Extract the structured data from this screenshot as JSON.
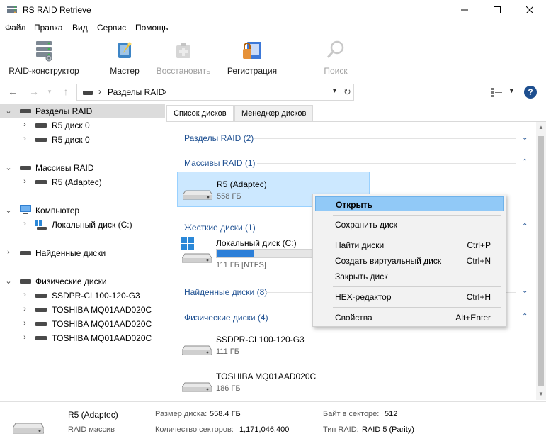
{
  "window": {
    "title": "RS RAID Retrieve"
  },
  "menu": [
    "Файл",
    "Правка",
    "Вид",
    "Сервис",
    "Помощь"
  ],
  "toolbar": {
    "raid_builder": "RAID-конструктор",
    "wizard": "Мастер",
    "restore": "Восстановить",
    "registration": "Регистрация",
    "search": "Поиск"
  },
  "address": {
    "path": "Разделы RAID"
  },
  "tree": {
    "raid_partitions": "Разделы RAID",
    "r5_disk_a": "R5 диск 0",
    "r5_disk_b": "R5 диск 0",
    "raid_arrays": "Массивы RAID",
    "r5_adaptec": "R5 (Adaptec)",
    "computer": "Компьютер",
    "local_disk": "Локальный диск (C:)",
    "found_disks": "Найденные диски",
    "physical_disks": "Физические диски",
    "phys_1": "SSDPR-CL100-120-G3",
    "phys_2": "TOSHIBA MQ01AAD020C",
    "phys_3": "TOSHIBA MQ01AAD020C",
    "phys_4": "TOSHIBA MQ01AAD020C"
  },
  "tabs": {
    "disk_list": "Список дисков",
    "disk_manager": "Менеджер дисков"
  },
  "sections": {
    "raid_partitions": "Разделы RAID (2)",
    "raid_arrays": "Массивы RAID (1)",
    "hard_disks": "Жесткие диски (1)",
    "found_disks": "Найденные диски (8)",
    "physical_disks": "Физические диски (4)"
  },
  "items": {
    "r5": {
      "name": "R5 (Adaptec)",
      "size": "558 ГБ"
    },
    "local": {
      "name": "Локальный диск (C:)",
      "size": "111 ГБ [NTFS]",
      "usage": 0.25
    },
    "ssd": {
      "name": "SSDPR-CL100-120-G3",
      "size": "111 ГБ"
    },
    "toshiba": {
      "name": "TOSHIBA MQ01AAD020C",
      "size": "186 ГБ"
    }
  },
  "context_menu": {
    "open": "Открыть",
    "save_disk": "Сохранить диск",
    "find_disks": "Найти диски",
    "find_disks_key": "Ctrl+P",
    "create_virtual": "Создать виртуальный диск",
    "create_virtual_key": "Ctrl+N",
    "close_disk": "Закрыть диск",
    "hex_editor": "HEX-редактор",
    "hex_editor_key": "Ctrl+H",
    "properties": "Свойства",
    "properties_key": "Alt+Enter"
  },
  "status": {
    "name": "R5 (Adaptec)",
    "type": "RAID массив",
    "disk_size_label": "Размер диска:",
    "disk_size": "558.4 ГБ",
    "sectors_label": "Количество секторов:",
    "sectors": "1,171,046,400",
    "bytes_label": "Байт в секторе:",
    "bytes": "512",
    "raid_type_label": "Тип RAID:",
    "raid_type": "RAID 5 (Parity)"
  }
}
